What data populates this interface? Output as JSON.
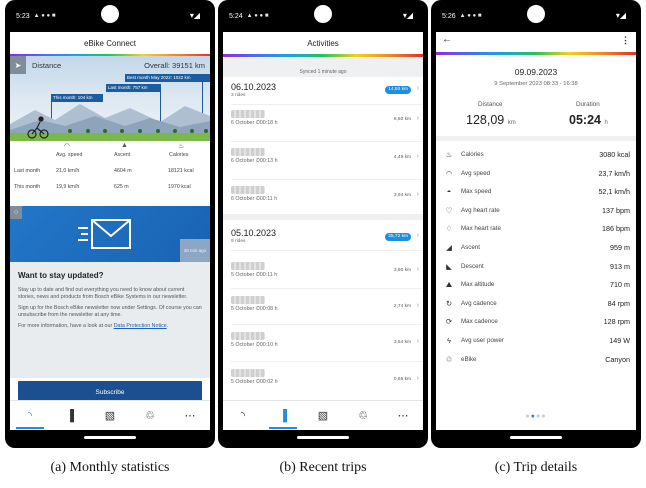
{
  "panel1": {
    "status_time": "5:23",
    "title": "eBike Connect",
    "distance_label": "Distance",
    "overall": "Overall: 39151 km",
    "best_month": "Best month May 2022: 1022 km",
    "last_month_bar": "Last month: 757 km",
    "this_month_bar": "This month: 104 km",
    "stat_headers": [
      "Avg. speed",
      "Ascent",
      "Calories"
    ],
    "stat_rows": [
      {
        "label": "Last month",
        "values": [
          "21,0 km/h",
          "4604 m",
          "18121 kcal"
        ]
      },
      {
        "label": "This month",
        "values": [
          "19,9 km/h",
          "625 m",
          "1970 kcal"
        ]
      }
    ],
    "news_time": "30 min ago",
    "news_title": "Want to stay updated?",
    "news_p1": "Stay up to date and find out everything you need to know about current stories, news and products from Bosch eBike Systems in our newsletter.",
    "news_p2": "Sign up for the Bosch eBike newsletter now under Settings. Of course you can unsubscribe from the newsletter at any time.",
    "news_p3_prefix": "For more information, have a look at our ",
    "news_p3_link": "Data Protection Notice",
    "news_p3_suffix": ".",
    "subscribe": "Subscribe",
    "caption": "(a) Monthly statistics"
  },
  "panel2": {
    "status_time": "5:24",
    "title": "Activities",
    "synced": "Synced 1 minute ago",
    "days": [
      {
        "date": "06.10.2023",
        "rides": "3 rides",
        "km": "14,93 km",
        "trips": [
          {
            "when": "6 October ⏲00:18 h",
            "km": "6,50 km"
          },
          {
            "when": "6 October ⏲00:13 h",
            "km": "4,49 km"
          },
          {
            "when": "6 October ⏲00:11 h",
            "km": "3,94 km"
          }
        ]
      },
      {
        "date": "05.10.2023",
        "rides": "9 rides",
        "km": "25,72 km",
        "trips": [
          {
            "when": "5 October ⏲00:11 h",
            "km": "3,80 km"
          },
          {
            "when": "5 October ⏲00:08 h",
            "km": "2,74 km"
          },
          {
            "when": "5 October ⏲00:10 h",
            "km": "3,54 km"
          },
          {
            "when": "5 October ⏲00:02 h",
            "km": "0,65 km"
          }
        ]
      }
    ],
    "caption": "(b) Recent trips"
  },
  "panel3": {
    "status_time": "5:26",
    "date": "09.09.2023",
    "range": "9 September 2023 08:33 - 16:38",
    "distance_label": "Distance",
    "distance_value": "128,09",
    "distance_unit": "km",
    "duration_label": "Duration",
    "duration_value": "05:24",
    "duration_unit": "h",
    "rows": [
      {
        "icon": "flame-icon",
        "glyph": "♨",
        "label": "Calories",
        "value": "3080 kcal"
      },
      {
        "icon": "speedometer-icon",
        "glyph": "◠",
        "label": "Avg speed",
        "value": "23,7 km/h"
      },
      {
        "icon": "max-speedometer-icon",
        "glyph": "◓",
        "label": "Max speed",
        "value": "52,1 km/h"
      },
      {
        "icon": "heart-icon",
        "glyph": "♡",
        "label": "Avg heart rate",
        "value": "137 bpm"
      },
      {
        "icon": "max-heart-icon",
        "glyph": "♢",
        "label": "Max heart rate",
        "value": "186 bpm"
      },
      {
        "icon": "ascent-icon",
        "glyph": "◢",
        "label": "Ascent",
        "value": "959 m"
      },
      {
        "icon": "descent-icon",
        "glyph": "◣",
        "label": "Descent",
        "value": "913 m"
      },
      {
        "icon": "altitude-icon",
        "glyph": "⛰",
        "label": "Max altitude",
        "value": "710 m"
      },
      {
        "icon": "cadence-icon",
        "glyph": "↻",
        "label": "Avg cadence",
        "value": "84 rpm"
      },
      {
        "icon": "max-cadence-icon",
        "glyph": "⟳",
        "label": "Max cadence",
        "value": "128 rpm"
      },
      {
        "icon": "bolt-icon",
        "glyph": "ϟ",
        "label": "Avg user power",
        "value": "149 W"
      },
      {
        "icon": "bike-icon",
        "glyph": "♲",
        "label": "eBike",
        "value": "Canyon"
      }
    ],
    "caption": "(c) Trip details"
  },
  "tabs": [
    {
      "icon": "feed-icon",
      "glyph": "◝"
    },
    {
      "icon": "stats-icon",
      "glyph": "▐"
    },
    {
      "icon": "map-icon",
      "glyph": "▧"
    },
    {
      "icon": "bike-icon",
      "glyph": "♲"
    },
    {
      "icon": "more-icon",
      "glyph": "⋯"
    }
  ],
  "colors": {
    "accent": "#1f8ee0",
    "brand_dark": "#1b4f8f",
    "bar": "#1b5d9f"
  }
}
